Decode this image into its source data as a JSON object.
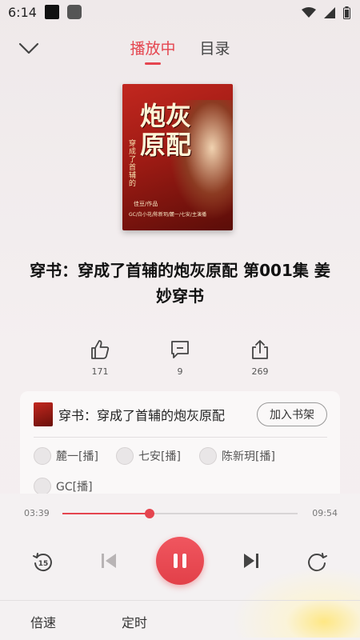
{
  "status_bar": {
    "time": "6:14"
  },
  "header": {
    "tabs": [
      {
        "label": "播放中",
        "active": true
      },
      {
        "label": "目录",
        "active": false
      }
    ]
  },
  "cover": {
    "title": "炮灰原配",
    "subtitle": "穿成了首辅的",
    "tag": "穿书",
    "author": "佳豆/作品",
    "credits": "GC/白小花/陈新玥/麓一/七安/主演播"
  },
  "track": {
    "title": "穿书：穿成了首辅的炮灰原配 第001集 姜妙穿书"
  },
  "actions": {
    "likes": "171",
    "comments": "9",
    "shares": "269"
  },
  "book_card": {
    "name": "穿书：穿成了首辅的炮灰原配",
    "shelf_button": "加入书架",
    "narrators": [
      "麓一[播]",
      "七安[播]",
      "陈新玥[播]",
      "GC[播]"
    ]
  },
  "player": {
    "current_time": "03:39",
    "total_time": "09:54",
    "progress": 0.37,
    "rewind_seconds": "15",
    "speed_label": "倍速",
    "timer_label": "定时"
  },
  "colors": {
    "accent": "#e5454f"
  }
}
